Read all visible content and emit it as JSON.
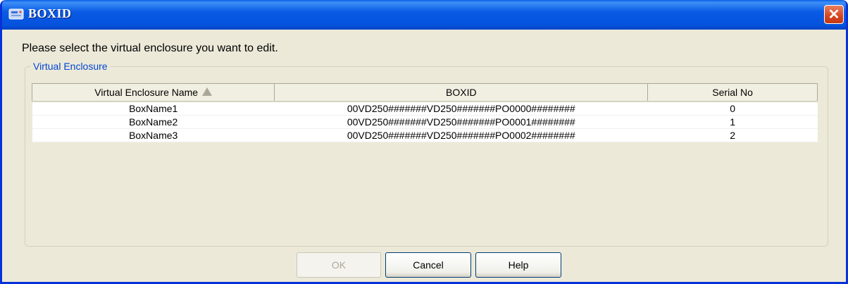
{
  "window": {
    "title": "BOXID",
    "close_symbol": "✕"
  },
  "instruction": "Please select the virtual enclosure you want to edit.",
  "group": {
    "label": "Virtual Enclosure"
  },
  "table": {
    "columns": [
      "Virtual Enclosure Name",
      "BOXID",
      "Serial No"
    ],
    "sort_column": "Virtual Enclosure Name",
    "sort_direction": "ascending",
    "rows": [
      [
        "BoxName1",
        "00VD250#######VD250#######PO0000########",
        "0"
      ],
      [
        "BoxName2",
        "00VD250#######VD250#######PO0001########",
        "1"
      ],
      [
        "BoxName3",
        "00VD250#######VD250#######PO0002########",
        "2"
      ]
    ]
  },
  "buttons": {
    "ok": "OK",
    "cancel": "Cancel",
    "help": "Help"
  },
  "icons": {
    "title": "virtual-disk-icon",
    "close": "close-icon",
    "sort": "sort-ascending-icon"
  },
  "colors": {
    "titlebar": "#0a5ae5",
    "close": "#d7441d",
    "group_label": "#0046d5",
    "dialog_bg": "#ece9d8"
  }
}
